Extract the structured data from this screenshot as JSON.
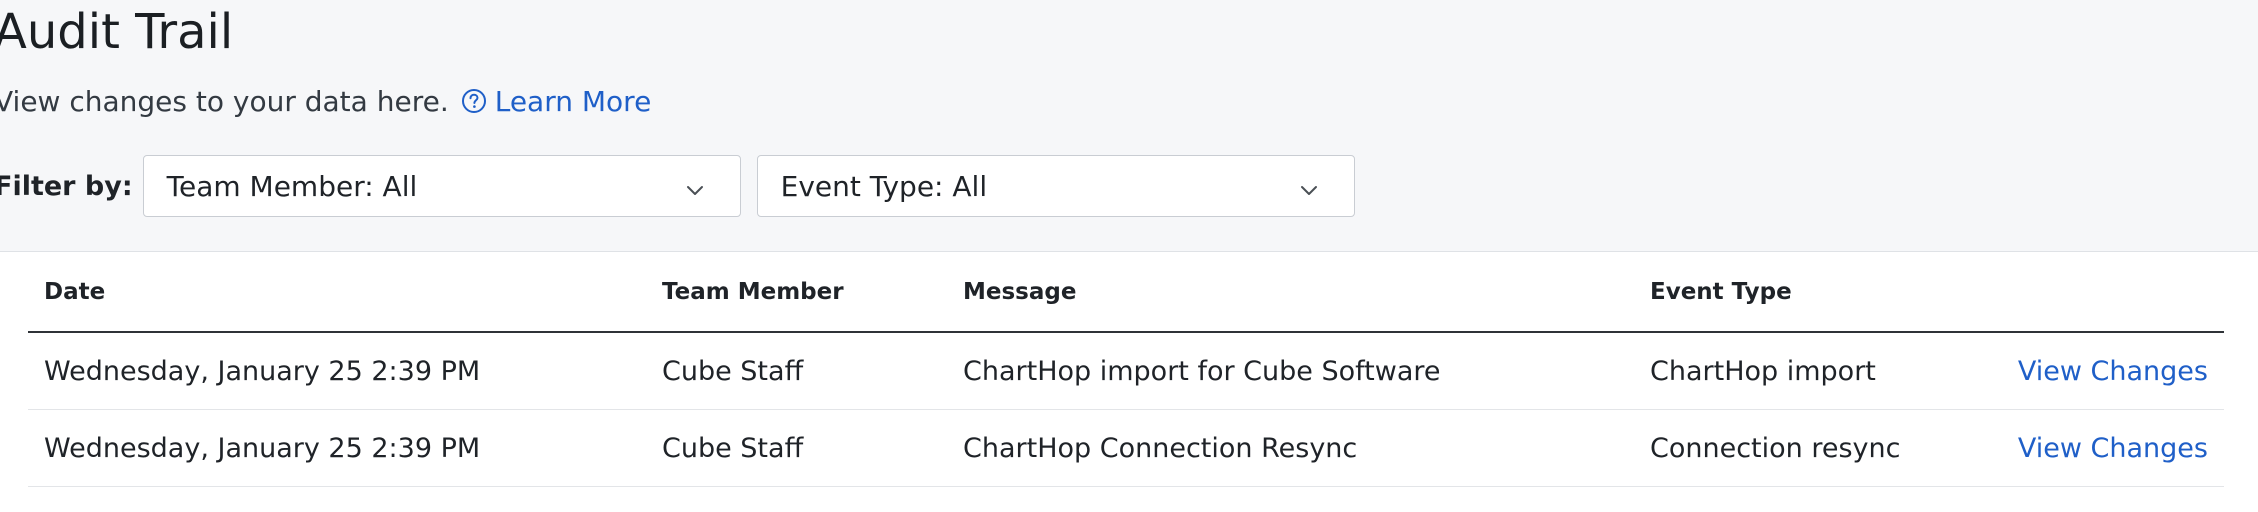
{
  "header": {
    "title": "Audit Trail",
    "subtitle": "View changes to your data here.",
    "help_link": "Learn More"
  },
  "filters": {
    "label": "Filter by:",
    "team_member": "Team Member: All",
    "event_type": "Event Type: All"
  },
  "table": {
    "columns": {
      "date": "Date",
      "team_member": "Team Member",
      "message": "Message",
      "event_type": "Event Type"
    },
    "rows": [
      {
        "date": "Wednesday, January 25 2:39 PM",
        "team_member": "Cube Staff",
        "message": "ChartHop import for Cube Software",
        "event_type": "ChartHop import",
        "action": "View Changes"
      },
      {
        "date": "Wednesday, January 25 2:39 PM",
        "team_member": "Cube Staff",
        "message": "ChartHop Connection Resync",
        "event_type": "Connection resync",
        "action": "View Changes"
      }
    ]
  },
  "colors": {
    "link": "#1f5fc8",
    "background": "#f6f7f9",
    "panel": "#ffffff"
  },
  "icons": {
    "help": "question-circle-icon",
    "dropdown": "chevron-down-icon"
  }
}
